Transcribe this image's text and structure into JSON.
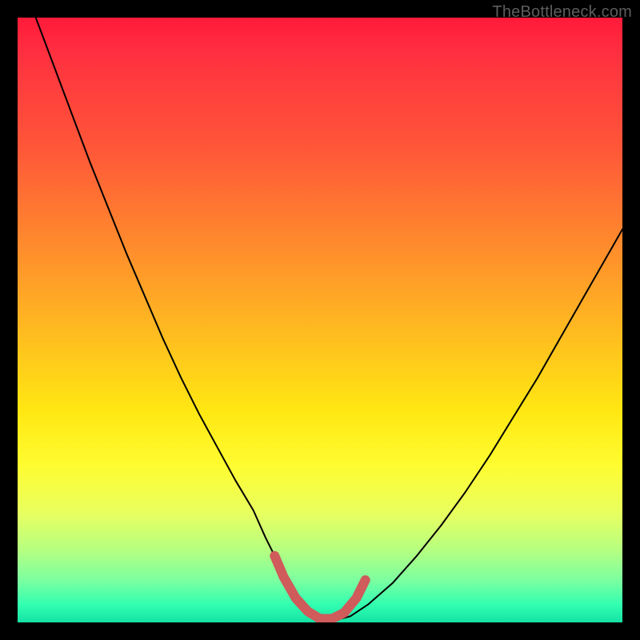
{
  "watermark": "TheBottleneck.com",
  "colors": {
    "frame": "#000000",
    "gradient_top": "#ff1a3a",
    "gradient_mid": "#ffe712",
    "gradient_bottom": "#14e2a5",
    "curve": "#000000",
    "highlight": "#cf5b5b"
  },
  "chart_data": {
    "type": "line",
    "title": "",
    "xlabel": "",
    "ylabel": "",
    "xlim": [
      0,
      100
    ],
    "ylim": [
      0,
      100
    ],
    "legend": false,
    "grid": false,
    "series": [
      {
        "name": "bottleneck-curve",
        "x": [
          3,
          6,
          9,
          12,
          15,
          18,
          21,
          24,
          27,
          30,
          33,
          36,
          39,
          41,
          43,
          45,
          47,
          49,
          51,
          53,
          55,
          58,
          62,
          66,
          70,
          74,
          78,
          82,
          86,
          90,
          94,
          98,
          100
        ],
        "y": [
          100,
          92,
          84,
          76,
          68.5,
          61,
          54,
          47,
          40.5,
          34.5,
          29,
          23.5,
          18.5,
          14,
          10,
          6.5,
          3.5,
          1.5,
          0.5,
          0.5,
          1,
          3,
          6.5,
          11,
          16,
          21.5,
          27.5,
          34,
          40.5,
          47.5,
          54.5,
          61.5,
          65
        ]
      },
      {
        "name": "optimal-zone-highlight",
        "x": [
          42.5,
          44,
          46,
          48,
          50,
          52,
          54,
          56,
          57.5
        ],
        "y": [
          11,
          7.5,
          4,
          1.8,
          0.6,
          0.6,
          1.6,
          4,
          7
        ]
      }
    ],
    "annotations": []
  }
}
